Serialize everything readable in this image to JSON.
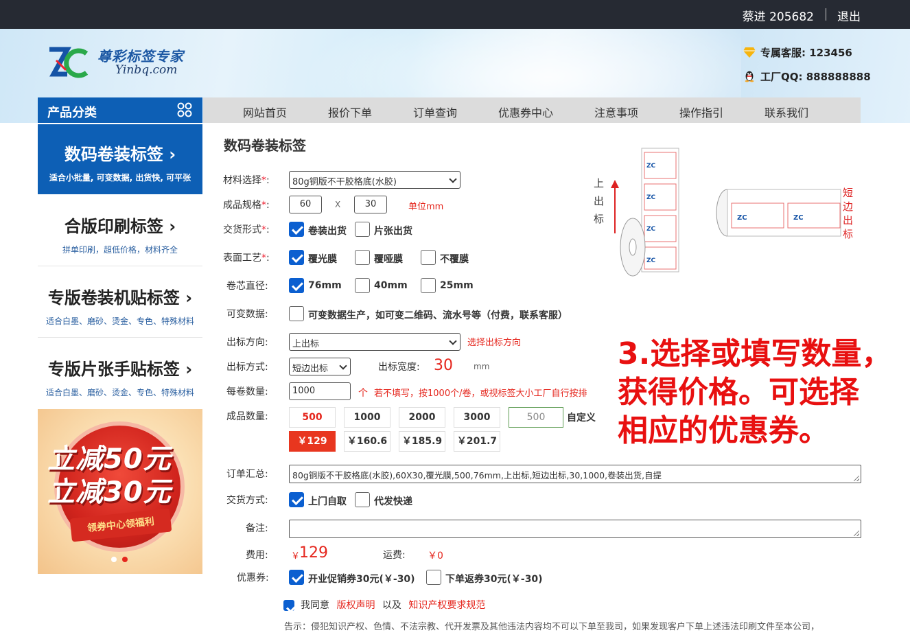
{
  "topbar": {
    "user": "蔡进  205682",
    "logout": "退出"
  },
  "brand": {
    "name": "尊彩标签专家",
    "site": "Yinbq.com"
  },
  "contact": {
    "service": "专属客服: 123456",
    "qq": "工厂QQ: 888888888"
  },
  "category_header": "产品分类",
  "nav": [
    "网站首页",
    "报价下单",
    "订单查询",
    "优惠券中心",
    "注意事项",
    "操作指引",
    "联系我们"
  ],
  "sidebar": [
    {
      "title": "数码卷装标签 ›",
      "desc": "适合小批量, 可变数据, 出货快, 可平张"
    },
    {
      "title": "合版印刷标签 ›",
      "desc": "拼单印刷，超低价格，材料齐全"
    },
    {
      "title": "专版卷装机贴标签 ›",
      "desc": "适合白墨、磨砂、烫金、专色、特殊材料"
    },
    {
      "title": "专版片张手贴标签 ›",
      "desc": "适合白墨、磨砂、烫金、专色、特殊材料"
    }
  ],
  "promo": {
    "line1": "立减50元",
    "line2": "立减30元",
    "ribbon": "领券中心领福利"
  },
  "page_title": "数码卷装标签",
  "form": {
    "material": {
      "label": "材料选择",
      "value": "80g铜版不干胶格底(水胶)"
    },
    "size": {
      "label": "成品规格",
      "width": "60",
      "x": "X",
      "height": "30",
      "unit": "单位mm"
    },
    "delivery_form": {
      "label": "交货形式",
      "options": [
        "卷装出货",
        "片张出货"
      ]
    },
    "surface": {
      "label": "表面工艺",
      "options": [
        "覆光膜",
        "覆哑膜",
        "不覆膜"
      ]
    },
    "core": {
      "label": "卷芯直径",
      "options": [
        "76mm",
        "40mm",
        "25mm"
      ]
    },
    "variable": {
      "label": "可变数据",
      "option": "可变数据生产，如可变二维码、流水号等（付费，联系客服）"
    },
    "direction": {
      "label": "出标方向",
      "value": "上出标",
      "hint": "选择出标方向"
    },
    "method": {
      "label": "出标方式",
      "value": "短边出标",
      "width_label": "出标宽度",
      "width_value": "30",
      "width_unit": "mm"
    },
    "per_roll": {
      "label": "每卷数量",
      "value": "1000",
      "unit": "个",
      "hint": "若不填写，按1000个/卷，或视标签大小工厂自行按排"
    },
    "quantity": {
      "label": "成品数量",
      "options": [
        "500",
        "1000",
        "2000",
        "3000"
      ],
      "custom_placeholder": "500",
      "custom_label": "自定义",
      "prices": [
        "￥129",
        "￥160.6",
        "￥185.9",
        "￥201.7"
      ]
    },
    "summary": {
      "label": "订单汇总",
      "value": "80g铜版不干胶格底(水胶),60X30,覆光膜,500,76mm,上出标,短边出标,30,1000,卷装出货,自提"
    },
    "ship": {
      "label": "交货方式",
      "options": [
        "上门自取",
        "代发快递"
      ]
    },
    "remark": {
      "label": "备注"
    },
    "fee": {
      "label": "费用",
      "currency": "￥",
      "value": "129",
      "freight_label": "运费",
      "freight": "￥0"
    },
    "coupon": {
      "label": "优惠券",
      "options": [
        "开业促销券30元(￥-30)",
        "下单返券30元(￥-30)"
      ]
    },
    "agree": {
      "prefix": "我同意",
      "link1": "版权声明",
      "mid": "以及",
      "link2": "知识产权要求规范"
    },
    "notice": "告示：侵犯知识产权、色情、不法宗教、代开发票及其他违法内容均不可以下单至我司，如果发现客户下单上述违法印刷文件至本公司，"
  },
  "illustration": {
    "left_text": [
      "上",
      "出",
      "标"
    ],
    "right_text": [
      "短",
      "边",
      "出",
      "标"
    ]
  },
  "overlay_text": [
    "3.选择或填写数量，",
    "获得价格。可选择",
    "相应的优惠券。"
  ],
  "colors": {
    "primary": "#0d5fb5",
    "accent": "#e5261d",
    "topbar": "#262a33"
  }
}
